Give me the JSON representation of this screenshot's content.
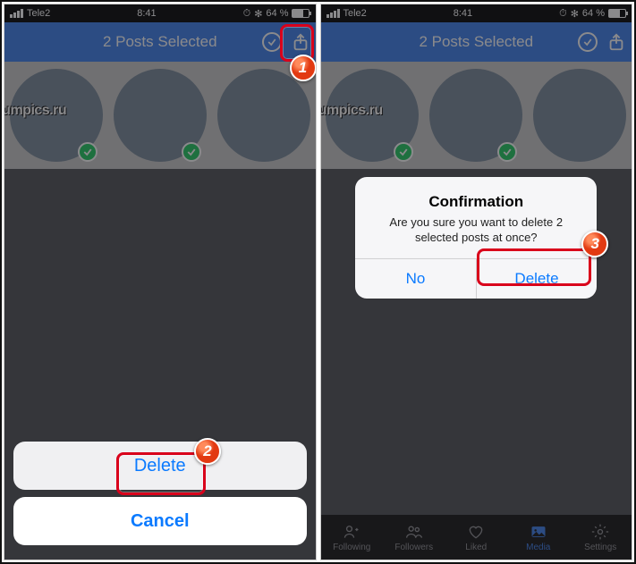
{
  "status": {
    "carrier": "Tele2",
    "time": "8:41",
    "battery_pct": "64 %"
  },
  "header": {
    "title": "2 Posts Selected"
  },
  "thumbs": {
    "watermark": "Lumpics.ru"
  },
  "actionsheet": {
    "delete": "Delete",
    "cancel": "Cancel"
  },
  "alert": {
    "title": "Confirmation",
    "message": "Are you sure you want to delete 2 selected posts at once?",
    "no": "No",
    "delete": "Delete"
  },
  "tabs": {
    "following": "Following",
    "followers": "Followers",
    "liked": "Liked",
    "media": "Media",
    "settings": "Settings"
  },
  "steps": {
    "one": "1",
    "two": "2",
    "three": "3"
  }
}
